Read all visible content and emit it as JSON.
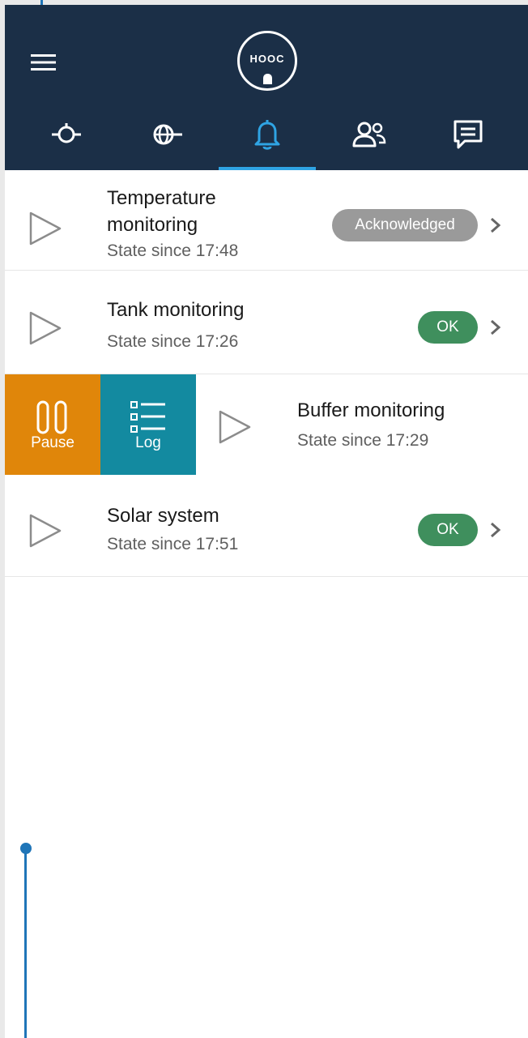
{
  "header": {
    "logo_text": "HOOC",
    "tabs": [
      {
        "icon": "device-icon",
        "active": false
      },
      {
        "icon": "globe-icon",
        "active": false
      },
      {
        "icon": "bell-icon",
        "active": true
      },
      {
        "icon": "users-icon",
        "active": false
      },
      {
        "icon": "chat-icon",
        "active": false
      }
    ],
    "colors": {
      "header_bg": "#1b2f47",
      "active_tab": "#2fa4e4"
    }
  },
  "alarms": [
    {
      "title": "Temperature monitoring",
      "subtitle": "State since 17:48",
      "status": "Acknowledged"
    },
    {
      "title": "Tank monitoring",
      "subtitle": "State since 17:26",
      "status": "OK"
    },
    {
      "title": "Buffer monitoring",
      "subtitle": "State since 17:29",
      "swiped": true
    },
    {
      "title": "Solar system",
      "subtitle": "State since 17:51",
      "status": "OK"
    }
  ],
  "swipe_actions": {
    "pause_label": "Pause",
    "log_label": "Log",
    "colors": {
      "pause": "#e0860a",
      "log": "#138aa0"
    }
  },
  "status_colors": {
    "acknowledged": "#9a9a9a",
    "ok": "#3f8f5d"
  }
}
